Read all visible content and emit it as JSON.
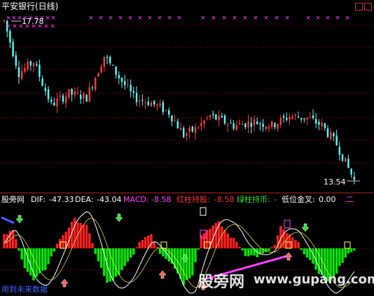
{
  "price_panel": {
    "title": "平安银行(日线)",
    "high_label": "17.78",
    "low_label": "13.54",
    "marker_glyph": "×"
  },
  "indicator_panel": {
    "name": "股旁网",
    "dif_label": "DIF:",
    "dif_value": "-47.33",
    "dea_label": "DEA:",
    "dea_value": "-43.04",
    "macd_label": "MACD:",
    "macd_value": "-8.58",
    "red_label": "红柱持股:",
    "red_value": "-8.58",
    "green_label": "绿柱持币:",
    "green_value": "-",
    "gold_label": "低位金叉:",
    "gold_value": "0.00",
    "extra_value": "二",
    "footer_text": "用到未来数据"
  },
  "watermark": {
    "cn": "股旁网",
    "url": "www.gupang.com"
  },
  "colors": {
    "up": "#ff3c3c",
    "down": "#54ffff",
    "macd_red": "#ff2020",
    "macd_green": "#00e800",
    "magenta": "#ff40ff",
    "grid": "#a00000",
    "dif": "#ffffff",
    "dea": "#ffff50"
  },
  "chart_data": [
    {
      "type": "candlestick",
      "title": "平安银行(日线)",
      "y_high": 17.78,
      "y_low": 13.54,
      "trend_anchors": [
        [
          0,
          17.78
        ],
        [
          5,
          16.4
        ],
        [
          10,
          16.7
        ],
        [
          16,
          15.55
        ],
        [
          22,
          15.85
        ],
        [
          28,
          15.75
        ],
        [
          34,
          16.85
        ],
        [
          38,
          16.4
        ],
        [
          44,
          15.75
        ],
        [
          50,
          15.6
        ],
        [
          56,
          15.35
        ],
        [
          61,
          14.75
        ],
        [
          65,
          14.9
        ],
        [
          70,
          15.25
        ],
        [
          78,
          15.0
        ],
        [
          85,
          15.1
        ],
        [
          91,
          15.0
        ],
        [
          97,
          15.25
        ],
        [
          103,
          15.2
        ],
        [
          108,
          15.0
        ],
        [
          113,
          14.5
        ],
        [
          119,
          13.54
        ]
      ]
    },
    {
      "type": "bar",
      "title": "MACD",
      "dif": -47.33,
      "dea": -43.04,
      "macd": -8.58,
      "bar_anchors": [
        [
          0,
          8
        ],
        [
          3,
          11
        ],
        [
          7,
          -12
        ],
        [
          10,
          -20
        ],
        [
          14,
          -13
        ],
        [
          19,
          6
        ],
        [
          24,
          18
        ],
        [
          28,
          14
        ],
        [
          31,
          -3
        ],
        [
          35,
          -22
        ],
        [
          39,
          -17
        ],
        [
          43,
          -6
        ],
        [
          47,
          6
        ],
        [
          50,
          9
        ],
        [
          53,
          -3
        ],
        [
          57,
          -9
        ],
        [
          61,
          -22
        ],
        [
          64,
          -16
        ],
        [
          67,
          8
        ],
        [
          70,
          13
        ],
        [
          73,
          16
        ],
        [
          76,
          9
        ],
        [
          79,
          4
        ],
        [
          82,
          -4
        ],
        [
          86,
          -5
        ],
        [
          89,
          -3
        ],
        [
          92,
          2
        ],
        [
          94,
          13
        ],
        [
          97,
          8
        ],
        [
          100,
          3
        ],
        [
          103,
          -6
        ],
        [
          107,
          -15
        ],
        [
          110,
          -21
        ],
        [
          113,
          -15
        ],
        [
          116,
          -5
        ],
        [
          119,
          -2
        ]
      ]
    }
  ]
}
